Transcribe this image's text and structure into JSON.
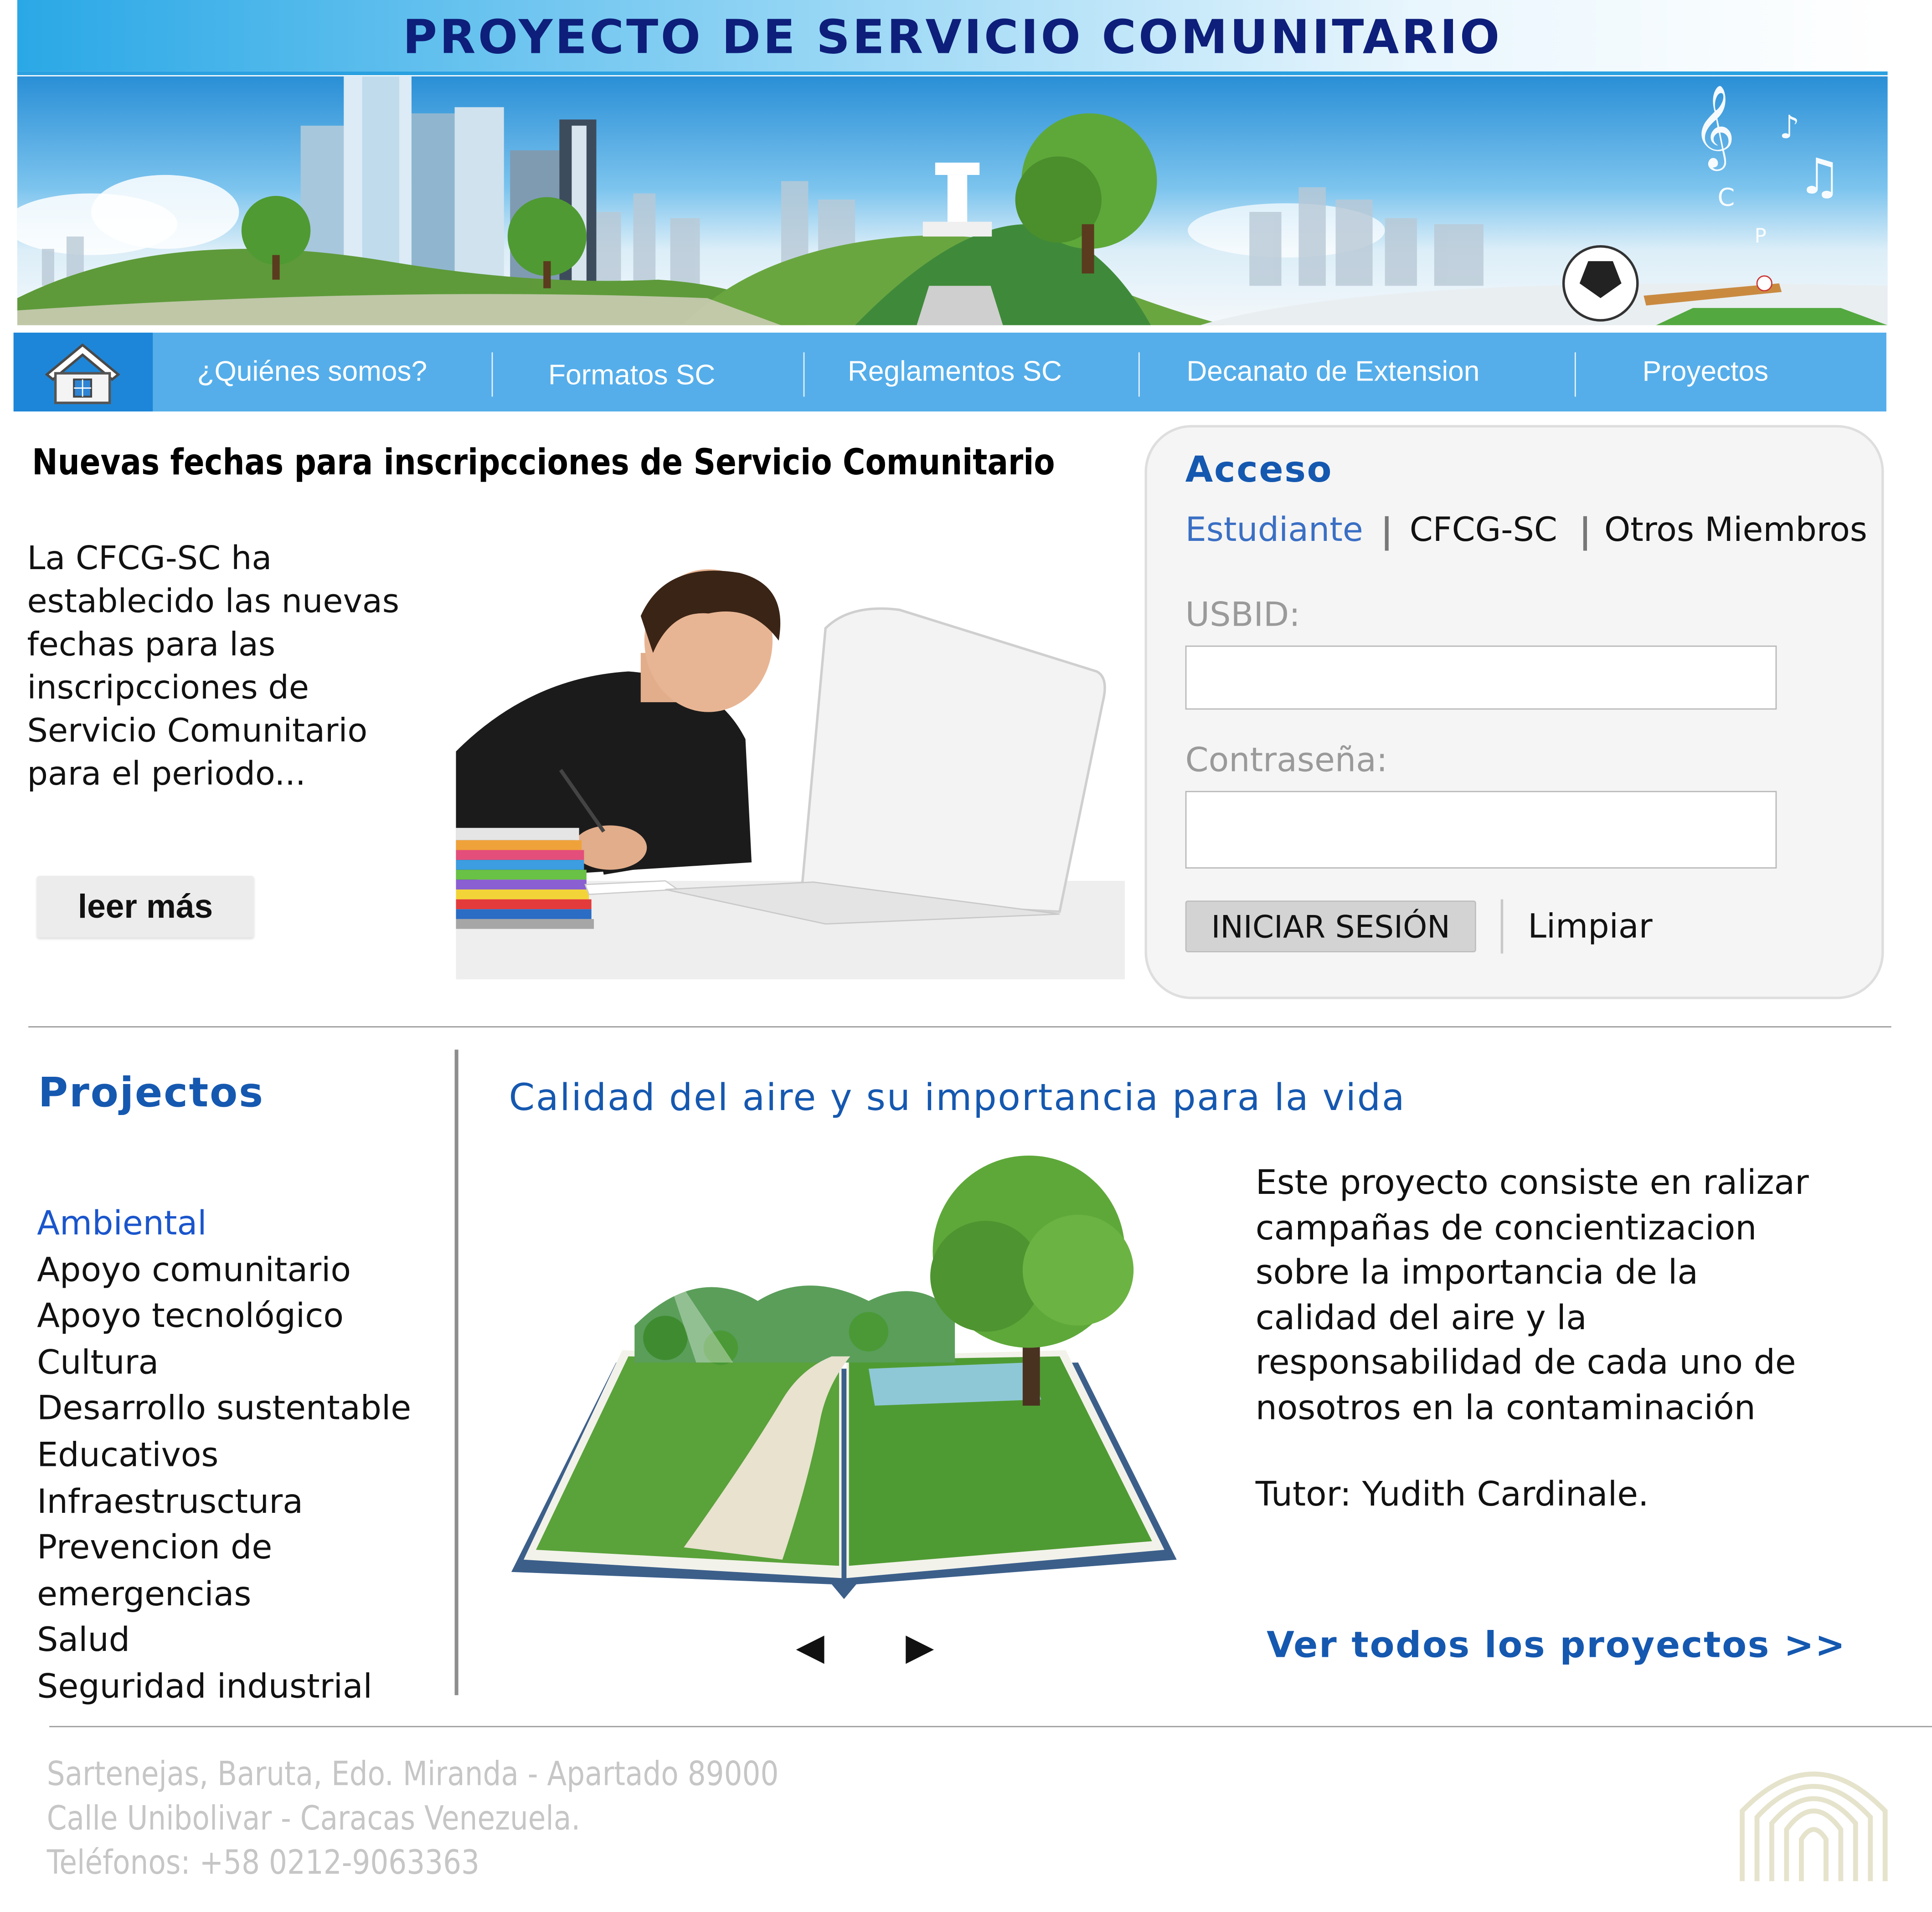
{
  "header": {
    "title": "PROYECTO DE SERVICIO COMUNITARIO"
  },
  "nav": {
    "home_icon": "house-icon",
    "items": [
      "¿Quiénes somos?",
      "Formatos SC",
      "Reglamentos SC",
      "Decanato de Extension",
      "Proyectos"
    ]
  },
  "news": {
    "title": "Nuevas fechas para inscripcciones de Servicio Comunitario",
    "lines": [
      "La CFCG-SC ha",
      "establecido las nuevas",
      "fechas para las",
      "inscripcciones de",
      "Servicio Comunitario",
      "para el periodo..."
    ],
    "read_more": "leer más"
  },
  "login": {
    "title": "Acceso",
    "tabs": [
      "Estudiante",
      "CFCG-SC",
      "Otros Miembros"
    ],
    "active_tab": "Estudiante",
    "usbid_label": "USBID:",
    "usbid_value": "",
    "password_label": "Contraseña:",
    "password_value": "",
    "submit": "INICIAR SESIÓN",
    "clear": "Limpiar"
  },
  "projects": {
    "heading": "Projectos",
    "categories": [
      "Ambiental",
      "Apoyo comunitario",
      "Apoyo tecnológico",
      "Cultura",
      "Desarrollo sustentable",
      "Educativos",
      "Infraestrusctura",
      "Prevencion de",
      "emergencias",
      "Salud",
      "Seguridad industrial"
    ],
    "active_category": "Ambiental",
    "featured": {
      "title": "Calidad del aire y su importancia para la vida",
      "description": [
        "Este proyecto consiste en ralizar",
        "campañas de concientizacion",
        "sobre la importancia de la",
        "calidad del aire y la",
        "responsabilidad de cada uno de",
        "nosotros en la contaminación"
      ],
      "tutor": "Tutor: Yudith Cardinale."
    },
    "prev_icon": "◀",
    "next_icon": "▶",
    "see_all": "Ver todos los proyectos >>"
  },
  "footer": {
    "lines": [
      "Sartenejas, Baruta, Edo. Miranda - Apartado 89000",
      "Calle Unibolivar - Caracas Venezuela.",
      "Teléfonos: +58 0212-9063363"
    ],
    "logo_icon": "university-logo-icon"
  },
  "colors": {
    "title_text": "#0d1f7a",
    "nav_bg": "#55aeea",
    "nav_home_bg": "#1e86d8",
    "accent_blue": "#1558b0",
    "active_link": "#1a55cc",
    "footer_text": "#c6c6c6"
  }
}
